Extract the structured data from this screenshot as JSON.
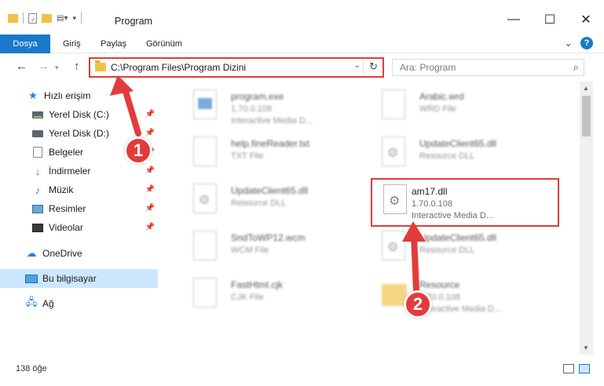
{
  "window": {
    "title": "Program",
    "minimize": "—",
    "maximize": "☐",
    "close": "✕"
  },
  "ribbon": {
    "tabs": [
      {
        "label": "Dosya"
      },
      {
        "label": "Giriş"
      },
      {
        "label": "Paylaş"
      },
      {
        "label": "Görünüm"
      }
    ],
    "expand_glyph": "⌄",
    "help_glyph": "?"
  },
  "address": {
    "path": "C:\\Program Files\\Program Dizini",
    "search_placeholder": "Ara: Program"
  },
  "nav": {
    "items": [
      {
        "label": "Hızlı erişim",
        "icon": "star-icon"
      },
      {
        "label": "Yerel Disk (C:)",
        "icon": "drive-icon",
        "pinned": true
      },
      {
        "label": "Yerel Disk (D:)",
        "icon": "drive-icon",
        "pinned": true
      },
      {
        "label": "Belgeler",
        "icon": "documents-icon",
        "pinned": true
      },
      {
        "label": "İndirmeler",
        "icon": "download-icon",
        "pinned": true
      },
      {
        "label": "Müzik",
        "icon": "music-icon",
        "pinned": true
      },
      {
        "label": "Resimler",
        "icon": "pictures-icon",
        "pinned": true
      },
      {
        "label": "Videolar",
        "icon": "videos-icon",
        "pinned": true
      },
      {
        "label": "OneDrive",
        "icon": "cloud-icon"
      },
      {
        "label": "Bu bilgisayar",
        "icon": "computer-icon",
        "selected": true
      },
      {
        "label": "Ağ",
        "icon": "network-icon"
      }
    ]
  },
  "files": [
    {
      "name": "program.exe",
      "line1": "1.70.0.108",
      "line2": "Interactive Media D...",
      "icon": "exe"
    },
    {
      "name": "Arabic.wrd",
      "line1": "WRD File",
      "line2": "",
      "icon": "doc"
    },
    {
      "name": "help.fineReader.txt",
      "line1": "TXT File",
      "line2": "",
      "icon": "doc"
    },
    {
      "name": "UpdateClient65.dll",
      "line1": "Resource DLL",
      "line2": "",
      "icon": "gear"
    },
    {
      "name": "UpdateClient65.dll",
      "line1": "Resource DLL",
      "line2": "",
      "icon": "gear"
    },
    {
      "name": "am17.dll",
      "line1": "1.70.0.108",
      "line2": "Interactive Media D...",
      "icon": "gear",
      "highlighted": true
    },
    {
      "name": "SndToWP12.wcm",
      "line1": "WCM File",
      "line2": "",
      "icon": "doc"
    },
    {
      "name": "UpdateClient65.dll",
      "line1": "Resource DLL",
      "line2": "",
      "icon": "gear"
    },
    {
      "name": "FastHtml.cjk",
      "line1": "CJK File",
      "line2": "",
      "icon": "doc"
    },
    {
      "name": "Resource",
      "line1": "1.70.0.108",
      "line2": "Interactive Media D...",
      "icon": "folder"
    }
  ],
  "status": {
    "count": "138 öğe"
  },
  "callouts": [
    "1",
    "2"
  ],
  "colors": {
    "accent": "#1979ca",
    "highlight": "#e33b3b",
    "selected_bg": "#cce8ff"
  }
}
